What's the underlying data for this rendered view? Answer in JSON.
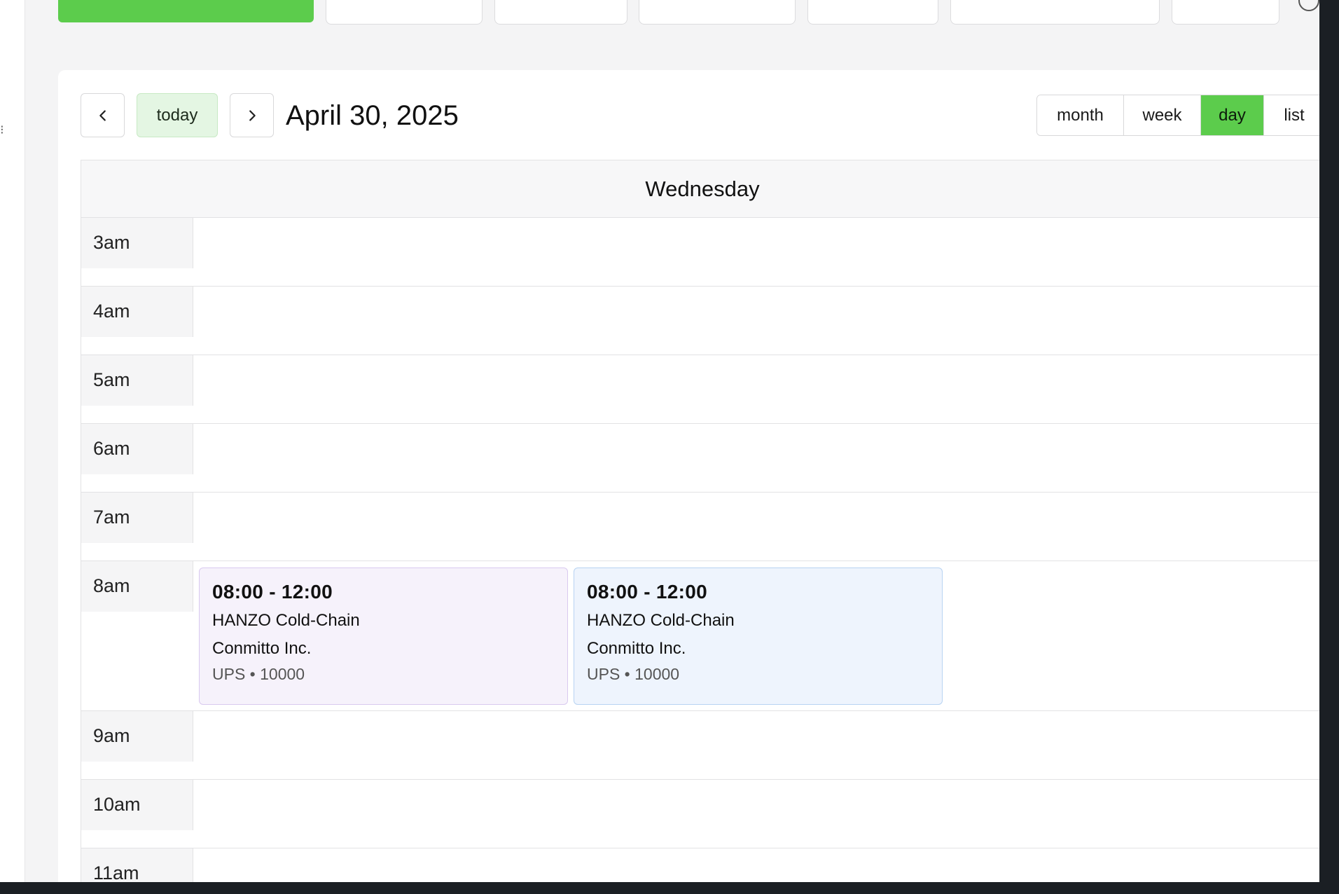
{
  "calendar": {
    "title": "April 30, 2025",
    "today_label": "today",
    "prev_glyph": "‹",
    "next_glyph": "›",
    "views": [
      {
        "label": "month",
        "active": false
      },
      {
        "label": "week",
        "active": false
      },
      {
        "label": "day",
        "active": true
      },
      {
        "label": "list",
        "active": false
      }
    ],
    "day_header": "Wednesday",
    "slots": [
      "3am",
      "4am",
      "5am",
      "6am",
      "7am",
      "8am",
      "9am",
      "10am",
      "11am"
    ],
    "events": [
      {
        "time": "08:00 - 12:00",
        "line1": "HANZO Cold-Chain",
        "line2": "Conmitto Inc.",
        "meta": "UPS • 10000"
      },
      {
        "time": "08:00 - 12:00",
        "line1": "HANZO Cold-Chain",
        "line2": "Conmitto Inc.",
        "meta": "UPS • 10000"
      }
    ]
  },
  "colors": {
    "accent_green": "#5ccc4c",
    "today_bg": "#e4f6e3",
    "event1_bg": "#f6f2fb",
    "event2_bg": "#eef4fd"
  },
  "icons": {
    "prev": "chevron-left-icon",
    "next": "chevron-right-icon"
  }
}
